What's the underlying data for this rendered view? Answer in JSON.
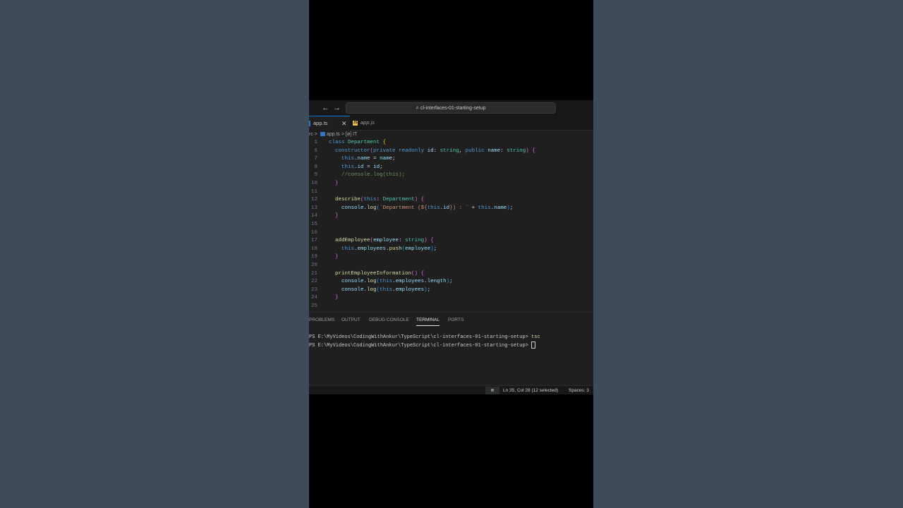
{
  "titlebar": {
    "back_arrow": "←",
    "forward_arrow": "→",
    "search_icon": "⌕",
    "command_center": "cl-interfaces-01-starting-setup"
  },
  "tabs": [
    {
      "label": "app.ts",
      "close": "✕"
    },
    {
      "label": "app.js",
      "icon": "JS"
    }
  ],
  "breadcrumb": {
    "folder": "rc",
    "sep1": ">",
    "file": "app.ts",
    "sep2": ">",
    "symbol": "[ø] IT"
  },
  "editor": {
    "lines": [
      {
        "n": "1",
        "html": "<span class='kw'>class</span> <span class='cls'>Department</span> <span class='brk'>{</span>"
      },
      {
        "n": "6",
        "html": "  <span class='kw'>constructor</span><span class='brk2'>(</span><span class='kw'>private</span> <span class='kw'>readonly</span> <span class='var'>id</span>: <span class='cls'>string</span>, <span class='kw'>public</span> <span class='var'>name</span>: <span class='cls'>string</span><span class='brk2'>)</span> <span class='brk2'>{</span>"
      },
      {
        "n": "7",
        "html": "    <span class='kw'>this</span>.<span class='var'>name</span> = <span class='var'>name</span>;"
      },
      {
        "n": "8",
        "html": "    <span class='kw'>this</span>.<span class='var'>id</span> = <span class='var'>id</span>;"
      },
      {
        "n": "9",
        "html": "    <span class='com'>//console.log(this);</span>"
      },
      {
        "n": "10",
        "html": "  <span class='brk2'>}</span>"
      },
      {
        "n": "11",
        "html": ""
      },
      {
        "n": "12",
        "html": "  <span class='fn'>describe</span><span class='brk2'>(</span><span class='kw'>this</span>: <span class='cls'>Department</span><span class='brk2'>)</span> <span class='brk2'>{</span>"
      },
      {
        "n": "13",
        "html": "    <span class='var'>console</span>.<span class='fn'>log</span><span class='brk3'>(</span><span class='str'>`Department (${</span><span class='kw'>this</span>.<span class='var'>id</span><span class='str'>}) : `</span> + <span class='kw'>this</span>.<span class='var'>name</span><span class='brk3'>)</span>;"
      },
      {
        "n": "14",
        "html": "  <span class='brk2'>}</span>"
      },
      {
        "n": "15",
        "html": ""
      },
      {
        "n": "16",
        "html": ""
      },
      {
        "n": "17",
        "html": "  <span class='fn'>addEmployee</span><span class='brk2'>(</span><span class='var'>employee</span>: <span class='cls'>string</span><span class='brk2'>)</span> <span class='brk2'>{</span>"
      },
      {
        "n": "18",
        "html": "    <span class='kw'>this</span>.<span class='var'>employees</span>.<span class='fn'>push</span><span class='brk3'>(</span><span class='var'>employee</span><span class='brk3'>)</span>;"
      },
      {
        "n": "19",
        "html": "  <span class='brk2'>}</span>"
      },
      {
        "n": "20",
        "html": ""
      },
      {
        "n": "21",
        "html": "  <span class='fn'>printEmployeeInformation</span><span class='brk2'>()</span> <span class='brk2'>{</span>"
      },
      {
        "n": "22",
        "html": "    <span class='var'>console</span>.<span class='fn'>log</span><span class='brk3'>(</span><span class='kw'>this</span>.<span class='var'>employees</span>.<span class='var'>length</span><span class='brk3'>)</span>;"
      },
      {
        "n": "23",
        "html": "    <span class='var'>console</span>.<span class='fn'>log</span><span class='brk3'>(</span><span class='kw'>this</span>.<span class='var'>employees</span><span class='brk3'>)</span>;"
      },
      {
        "n": "24",
        "html": "  <span class='brk2'>}</span>"
      },
      {
        "n": "25",
        "html": ""
      }
    ]
  },
  "panel": {
    "tabs": [
      "PROBLEMS",
      "OUTPUT",
      "DEBUG CONSOLE",
      "TERMINAL",
      "PORTS"
    ],
    "active_tab": "TERMINAL",
    "terminal": {
      "prompt1": "PS E:\\MyVideos\\CodingWithAnkur\\TypeScript\\cl-interfaces-01-starting-setup> ",
      "cmd1": "tsc",
      "prompt2": "PS E:\\MyVideos\\CodingWithAnkur\\TypeScript\\cl-interfaces-01-starting-setup> "
    }
  },
  "statusbar": {
    "zoom_icon": "⊕",
    "position": "Ln 35, Col 28 (12 selected)",
    "spaces": "Spaces: 3"
  }
}
